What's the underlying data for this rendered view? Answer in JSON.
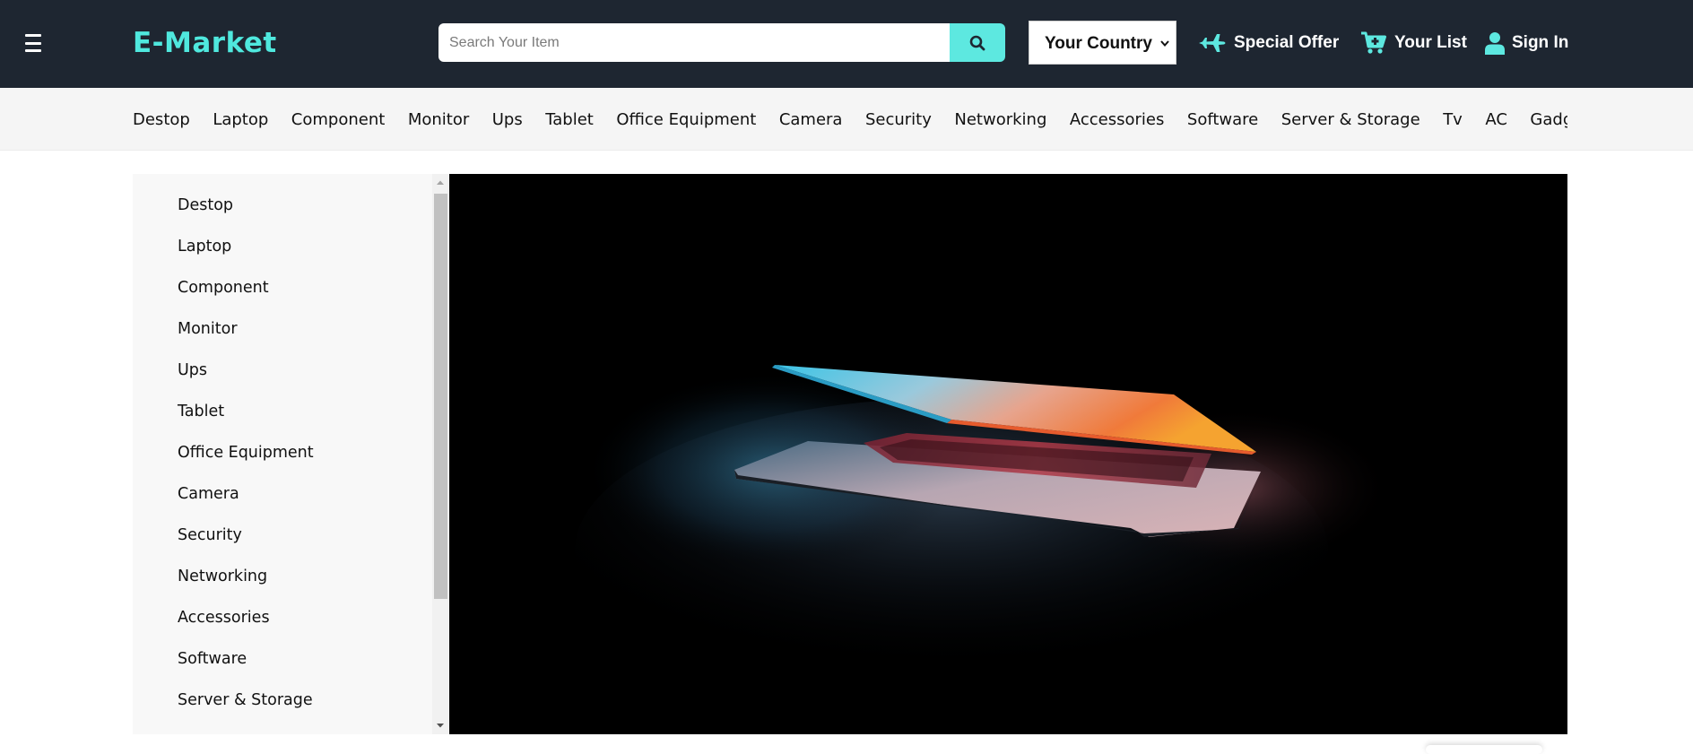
{
  "header": {
    "brand": "E-Market",
    "search": {
      "placeholder": "Search Your Item",
      "value": ""
    },
    "country_select": {
      "selected": "Your Country"
    },
    "links": {
      "special_offer": "Special Offer",
      "your_list": "Your List",
      "sign_in": "Sign In"
    },
    "icons": [
      "menu-icon",
      "search-icon",
      "chevron-down-icon",
      "airplane-icon",
      "cart-icon",
      "user-icon"
    ]
  },
  "category_nav": {
    "items": [
      "Destop",
      "Laptop",
      "Component",
      "Monitor",
      "Ups",
      "Tablet",
      "Office Equipment",
      "Camera",
      "Security",
      "Networking",
      "Accessories",
      "Software",
      "Server & Storage",
      "Tv",
      "AC",
      "Gadget"
    ]
  },
  "sidebar": {
    "items": [
      "Destop",
      "Laptop",
      "Component",
      "Monitor",
      "Ups",
      "Tablet",
      "Office Equipment",
      "Camera",
      "Security",
      "Networking",
      "Accessories",
      "Software",
      "Server & Storage"
    ]
  },
  "colors": {
    "header_bg": "#1e2631",
    "accent": "#5de8e0",
    "brand_text": "#4fe8de",
    "nav_bg": "#f5f5f5",
    "hero_bg": "#000000"
  }
}
